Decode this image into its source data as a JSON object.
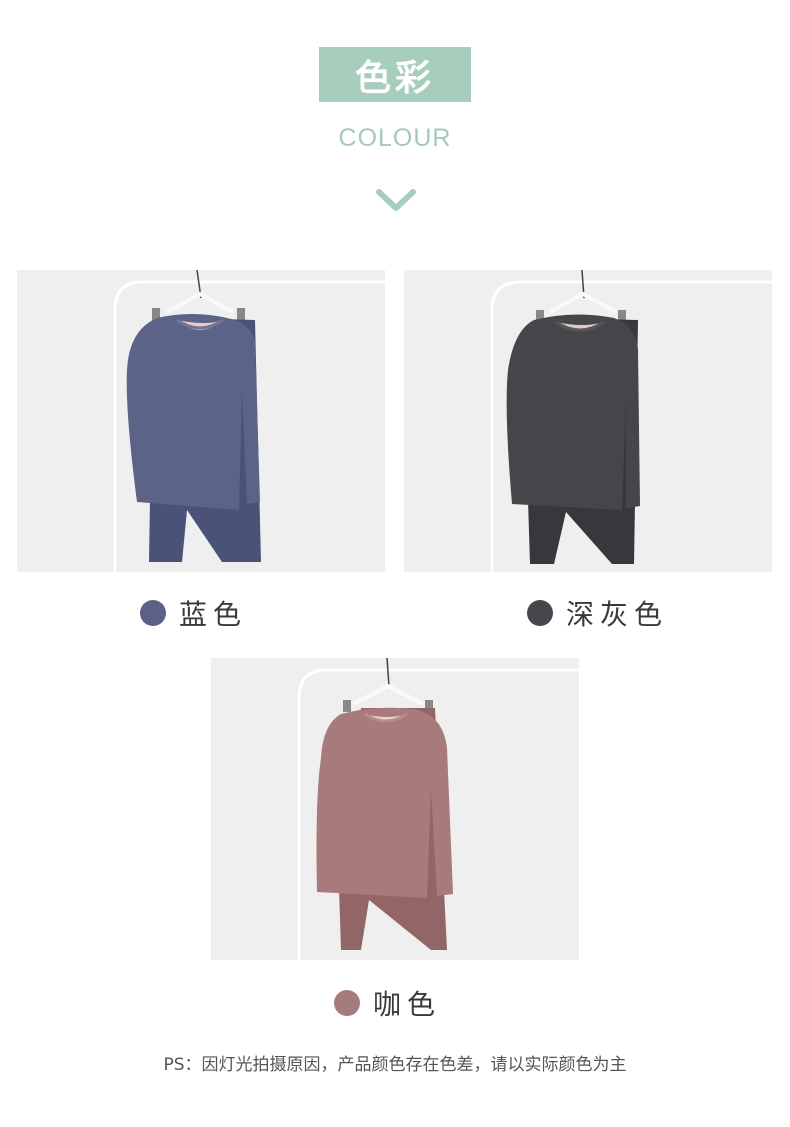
{
  "header": {
    "title": "色彩",
    "subtitle": "COLOUR",
    "accent_color": "#a7cebd",
    "icon": "chevron-down-icon"
  },
  "colors": [
    {
      "name": "蓝色",
      "swatch": "#5a6088",
      "garment": "#5b6389",
      "garment_shade": "#4a5277"
    },
    {
      "name": "深灰色",
      "swatch": "#45474d",
      "garment": "#44464a",
      "garment_shade": "#36383c"
    },
    {
      "name": "咖色",
      "swatch": "#a67b7c",
      "garment": "#a87a7b",
      "garment_shade": "#926667"
    }
  ],
  "footer": {
    "note": "PS：因灯光拍摄原因，产品颜色存在色差，请以实际颜色为主"
  }
}
